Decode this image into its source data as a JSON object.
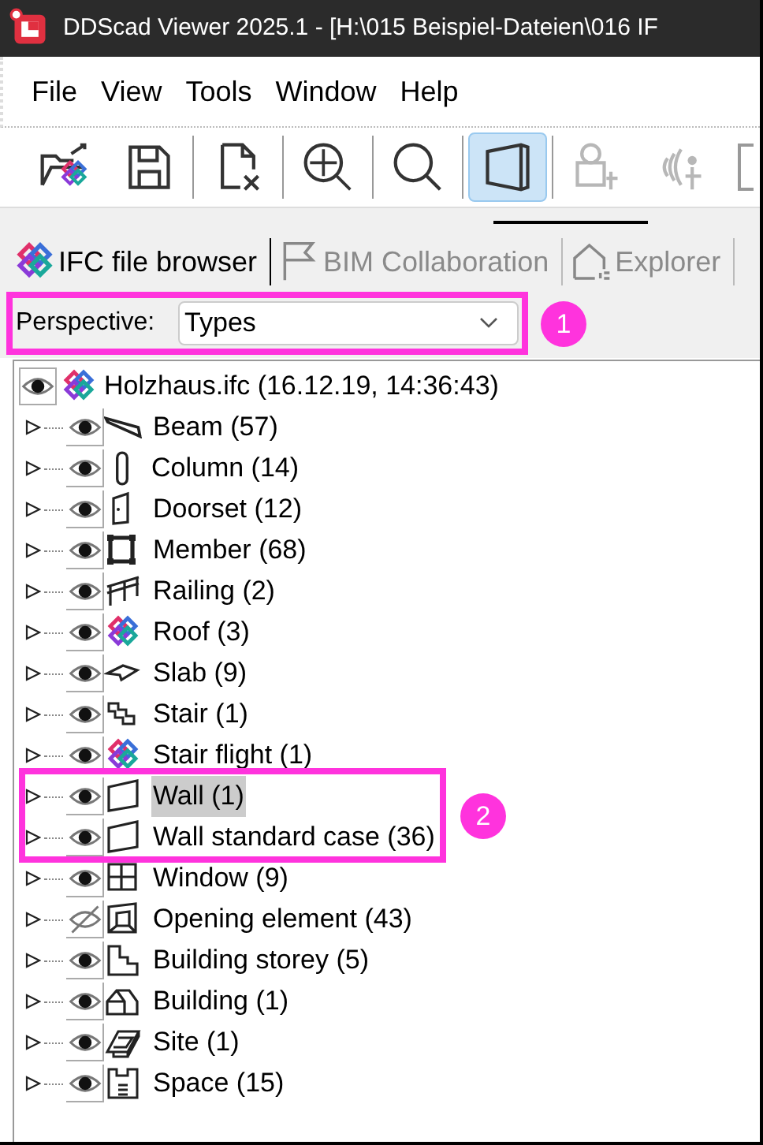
{
  "window": {
    "title": "DDScad Viewer 2025.1 - [H:\\015 Beispiel-Dateien\\016 IF"
  },
  "menu": [
    "File",
    "View",
    "Tools",
    "Window",
    "Help"
  ],
  "toolbar": [
    {
      "kind": "open",
      "pressed": false,
      "disabled": false
    },
    {
      "kind": "save",
      "pressed": false,
      "disabled": false
    },
    {
      "kind": "close-file",
      "pressed": false,
      "disabled": false
    },
    {
      "kind": "zoom-all",
      "pressed": false,
      "disabled": false
    },
    {
      "kind": "zoom",
      "pressed": false,
      "disabled": false
    },
    {
      "kind": "box",
      "pressed": true,
      "disabled": false
    },
    {
      "kind": "person-stamp",
      "pressed": false,
      "disabled": true
    },
    {
      "kind": "person-signal",
      "pressed": false,
      "disabled": true
    }
  ],
  "tabs": [
    {
      "label": "IFC file browser",
      "kind": "ifc",
      "selected": true
    },
    {
      "label": "BIM Collaboration",
      "kind": "flag",
      "selected": false
    },
    {
      "label": "Explorer",
      "kind": "house",
      "selected": false
    }
  ],
  "perspective": {
    "label": "Perspective:",
    "value": "Types"
  },
  "tree": {
    "root": {
      "label": "Holzhaus.ifc (16.12.19, 14:36:43)",
      "visible": true
    },
    "children": [
      {
        "label": "Beam (57)",
        "kind": "beam",
        "visible": true,
        "selected": false
      },
      {
        "label": "Column (14)",
        "kind": "column",
        "visible": true,
        "selected": false
      },
      {
        "label": "Doorset (12)",
        "kind": "door",
        "visible": true,
        "selected": false
      },
      {
        "label": "Member (68)",
        "kind": "frame",
        "visible": true,
        "selected": false
      },
      {
        "label": "Railing (2)",
        "kind": "railing",
        "visible": true,
        "selected": false
      },
      {
        "label": "Roof (3)",
        "kind": "logo",
        "visible": true,
        "selected": false
      },
      {
        "label": "Slab (9)",
        "kind": "slab",
        "visible": true,
        "selected": false
      },
      {
        "label": "Stair (1)",
        "kind": "stair",
        "visible": true,
        "selected": false
      },
      {
        "label": "Stair flight (1)",
        "kind": "logo",
        "visible": true,
        "selected": false
      },
      {
        "label": "Wall (1)",
        "kind": "wall",
        "visible": true,
        "selected": true
      },
      {
        "label": "Wall standard case (36)",
        "kind": "wall",
        "visible": true,
        "selected": false
      },
      {
        "label": "Window (9)",
        "kind": "window",
        "visible": true,
        "selected": false
      },
      {
        "label": "Opening element (43)",
        "kind": "opening",
        "visible": false,
        "selected": false
      },
      {
        "label": "Building storey (5)",
        "kind": "storey",
        "visible": true,
        "selected": false
      },
      {
        "label": "Building (1)",
        "kind": "building",
        "visible": true,
        "selected": false
      },
      {
        "label": "Site (1)",
        "kind": "site",
        "visible": true,
        "selected": false
      },
      {
        "label": "Space (15)",
        "kind": "space",
        "visible": true,
        "selected": false
      }
    ]
  },
  "callouts": [
    {
      "number": "1"
    },
    {
      "number": "2"
    }
  ]
}
